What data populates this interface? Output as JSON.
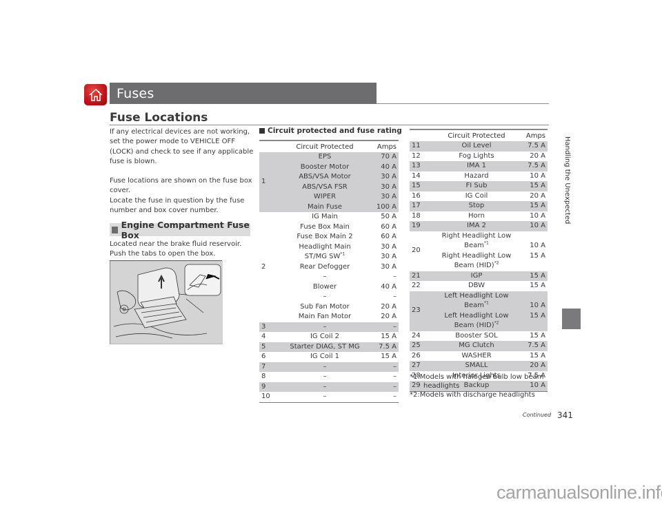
{
  "header": {
    "home_icon": "house-icon",
    "title": "Fuses",
    "section_title": "Fuse Locations"
  },
  "left": {
    "para1": "If any electrical devices are not working, set the power mode to VEHICLE OFF (LOCK) and check to see if any applicable fuse is blown.",
    "para2a": "Fuse locations are shown on the fuse box cover.",
    "para2b": "Locate the fuse in question by the fuse number and box cover number.",
    "subheading": "Engine Compartment Fuse Box",
    "para3": "Located near the brake fluid reservoir. Push the tabs to open the box.",
    "figure_label": "engine-fuse-box-illustration"
  },
  "circuit_heading": "Circuit protected and fuse rating",
  "table_headers": {
    "circuit": "Circuit Protected",
    "amps": "Amps"
  },
  "table1": {
    "group1": {
      "num": "1",
      "rows": [
        {
          "circuit": "EPS",
          "amps": "70 A"
        },
        {
          "circuit": "Booster Motor",
          "amps": "40 A"
        },
        {
          "circuit": "ABS/VSA Motor",
          "amps": "30 A"
        },
        {
          "circuit": "ABS/VSA FSR",
          "amps": "30 A"
        },
        {
          "circuit": "WIPER",
          "amps": "30 A"
        },
        {
          "circuit": "Main Fuse",
          "amps": "100 A"
        }
      ]
    },
    "group2": {
      "num": "2",
      "rows": [
        {
          "circuit": "IG Main",
          "amps": "50 A"
        },
        {
          "circuit": "Fuse Box Main",
          "amps": "60 A"
        },
        {
          "circuit": "Fuse Box Main 2",
          "amps": "60 A"
        },
        {
          "circuit": "Headlight Main",
          "amps": "30 A"
        },
        {
          "circuit": "ST/MG SW",
          "sup": "*1",
          "amps": "30 A"
        },
        {
          "circuit": "Rear Defogger",
          "amps": "30 A"
        },
        {
          "circuit": "–",
          "amps": "–"
        },
        {
          "circuit": "Blower",
          "amps": "40 A"
        },
        {
          "circuit": "–",
          "amps": "–"
        },
        {
          "circuit": "Sub Fan Motor",
          "amps": "20 A"
        },
        {
          "circuit": "Main Fan Motor",
          "amps": "20 A"
        }
      ]
    },
    "rows": [
      {
        "num": "3",
        "circuit": "–",
        "amps": "–"
      },
      {
        "num": "4",
        "circuit": "IG Coil 2",
        "amps": "15 A"
      },
      {
        "num": "5",
        "circuit": "Starter DIAG, ST MG",
        "amps": "7.5 A"
      },
      {
        "num": "6",
        "circuit": "IG Coil 1",
        "amps": "15 A"
      },
      {
        "num": "7",
        "circuit": "–",
        "amps": "–"
      },
      {
        "num": "8",
        "circuit": "–",
        "amps": "–"
      },
      {
        "num": "9",
        "circuit": "–",
        "amps": "–"
      },
      {
        "num": "10",
        "circuit": "–",
        "amps": "–"
      }
    ]
  },
  "table2": {
    "rows": [
      {
        "num": "11",
        "circuit": "Oil Level",
        "amps": "7.5 A"
      },
      {
        "num": "12",
        "circuit": "Fog Lights",
        "amps": "20 A"
      },
      {
        "num": "13",
        "circuit": "IMA 1",
        "amps": "7.5 A"
      },
      {
        "num": "14",
        "circuit": "Hazard",
        "amps": "10 A"
      },
      {
        "num": "15",
        "circuit": "FI Sub",
        "amps": "15 A"
      },
      {
        "num": "16",
        "circuit": "IG Coil",
        "amps": "20 A"
      },
      {
        "num": "17",
        "circuit": "Stop",
        "amps": "15 A"
      },
      {
        "num": "18",
        "circuit": "Horn",
        "amps": "10 A"
      },
      {
        "num": "19",
        "circuit": "IMA 2",
        "amps": "10 A"
      },
      {
        "num": "20",
        "circuit_a": "Right Headlight Low Beam",
        "sup_a": "*1",
        "circuit_b": "Right Headlight Low Beam (HID)",
        "sup_b": "*2",
        "amps_a": "10 A",
        "amps_b": "15 A"
      },
      {
        "num": "21",
        "circuit": "IGP",
        "amps": "15 A"
      },
      {
        "num": "22",
        "circuit": "DBW",
        "amps": "15 A"
      },
      {
        "num": "23",
        "circuit_a": "Left Headlight Low Beam",
        "sup_a": "*1",
        "circuit_b": "Left Headlight Low Beam (HID)",
        "sup_b": "*2",
        "amps_a": "10 A",
        "amps_b": "15 A"
      },
      {
        "num": "24",
        "circuit": "Booster SOL",
        "amps": "15 A"
      },
      {
        "num": "25",
        "circuit": "MG Clutch",
        "amps": "7.5 A"
      },
      {
        "num": "26",
        "circuit": "WASHER",
        "amps": "15 A"
      },
      {
        "num": "27",
        "circuit": "SMALL",
        "amps": "20 A"
      },
      {
        "num": "28",
        "circuit": "Interior Lights",
        "amps": "7.5 A"
      },
      {
        "num": "29",
        "circuit": "Backup",
        "amps": "10 A"
      }
    ]
  },
  "notes": {
    "note1": "*1:Models with halogen bulb low beam headlights",
    "note2": "*2:Models with discharge headlights"
  },
  "sidebar": {
    "chapter": "Handling the Unexpected"
  },
  "footer": {
    "continued": "Continued",
    "page_number": "341",
    "watermark": "carmanualsonline.info"
  }
}
